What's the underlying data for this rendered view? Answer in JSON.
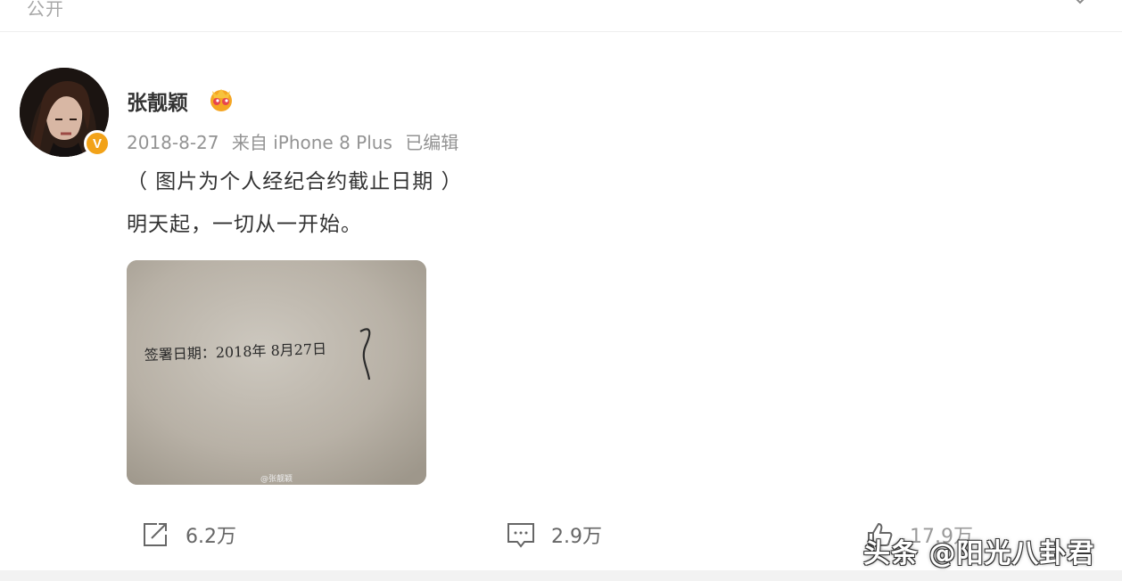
{
  "top": {
    "visibility_label": "公开"
  },
  "post": {
    "user_name": "张靓颖",
    "date": "2018-8-27",
    "source": "来自 iPhone 8 Plus",
    "edited": "已编辑",
    "text_line_1": "（ 图片为个人经纪合约截止日期 ）",
    "text_line_2": "明天起，一切从一开始。",
    "photo": {
      "handwriting": "签署日期：2018年 8月27日",
      "watermark": "@张靓颖"
    },
    "badges": {
      "verified": "V",
      "verified_color": "#f2a218"
    }
  },
  "actions": {
    "share_count": "6.2万",
    "comment_count": "2.9万",
    "like_count": "17.9万"
  },
  "overlay": {
    "source_watermark": "头条 @阳光八卦君"
  },
  "colors": {
    "name": "#333333",
    "meta": "#939393",
    "icon": "#666666",
    "vip": "#f5a623"
  }
}
